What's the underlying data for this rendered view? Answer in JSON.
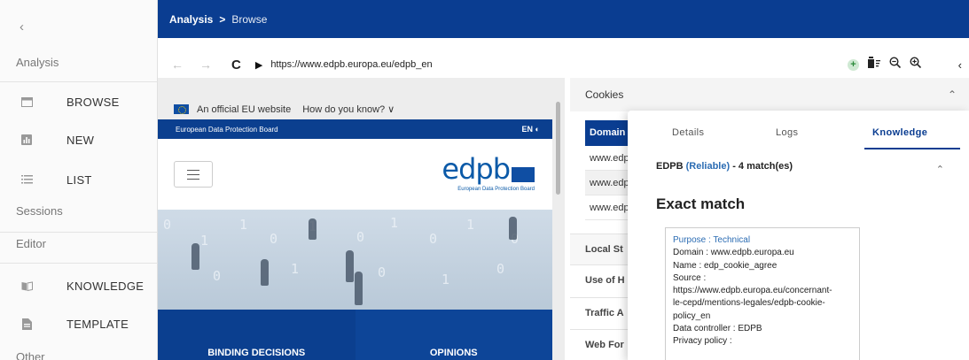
{
  "sidebar": {
    "collapse_icon": "chevron-left-icon",
    "sections": {
      "analysis": "Analysis",
      "sessions": "Sessions",
      "editor": "Editor",
      "other": "Other"
    },
    "items": [
      {
        "label": "BROWSE",
        "icon": "browser-window-icon"
      },
      {
        "label": "NEW",
        "icon": "bar-chart-icon"
      },
      {
        "label": "LIST",
        "icon": "list-icon"
      },
      {
        "label": "KNOWLEDGE",
        "icon": "book-icon"
      },
      {
        "label": "TEMPLATE",
        "icon": "document-icon"
      }
    ]
  },
  "header": {
    "breadcrumb_parent": "Analysis",
    "breadcrumb_separator": ">",
    "breadcrumb_current": "Browse"
  },
  "urlbar": {
    "url": "https://www.edpb.europa.eu/edpb_en",
    "tools": [
      "add-icon",
      "clear-cookies-icon",
      "zoom-out-icon",
      "zoom-in-icon"
    ]
  },
  "website": {
    "official_text": "An official EU website",
    "how_text": "How do you know? ∨",
    "board_name": "European Data Protection Board",
    "lang": "EN",
    "logo_word": "edpb",
    "logo_sub": "European Data Protection Board",
    "tiles": [
      "BINDING DECISIONS",
      "OPINIONS"
    ]
  },
  "cookies": {
    "title": "Cookies",
    "column_header": "Domain",
    "rows": [
      "www.edp",
      "www.edp",
      "www.edp"
    ],
    "sections": [
      "Local St",
      "Use of H",
      "Traffic A",
      "Web For"
    ]
  },
  "knowledge": {
    "tabs": [
      "Details",
      "Logs",
      "Knowledge"
    ],
    "active_tab": "Knowledge",
    "source_name": "EDPB",
    "reliability": "(Reliable)",
    "match_count": "- 4 match(es)",
    "exact_title": "Exact match",
    "card": {
      "purpose": "Purpose : Technical",
      "domain": "Domain : www.edpb.europa.eu",
      "name": "Name : edp_cookie_agree",
      "source_label": "Source :",
      "source_url_1": "https://www.edpb.europa.eu/concernant-",
      "source_url_2": "le-cepd/mentions-legales/edpb-cookie-",
      "source_url_3": "policy_en",
      "controller": "Data controller : EDPB",
      "privacy": "Privacy policy :"
    }
  },
  "colors": {
    "primary": "#0a3d91",
    "link": "#2b6cb3"
  }
}
